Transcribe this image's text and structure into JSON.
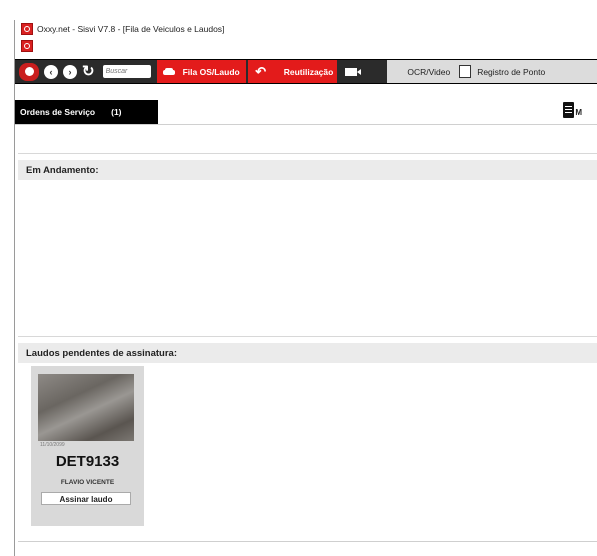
{
  "window": {
    "title": "Oxxy.net - Sisvi V7.8 - [Fila de Veiculos e Laudos]"
  },
  "toolbar": {
    "search_placeholder": "Buscar",
    "fila_label": "Fila OS/Laudo",
    "reutilizacao_label": "Reutilização",
    "ocr_label": "OCR/Video",
    "registro_label": "Registro de Ponto"
  },
  "tabs": {
    "ordens_label": "Ordens de Serviço",
    "ordens_count": "(1)",
    "doc_button_label": "M"
  },
  "sections": {
    "em_andamento": "Em Andamento:",
    "laudos_pendentes": "Laudos pendentes de assinatura:"
  },
  "laudo_card": {
    "meta": "11/10/2099",
    "plate": "DET9133",
    "name": "FLAVIO VICENTE",
    "button_label": "Assinar laudo"
  },
  "colors": {
    "toolbar_dark": "#2b2b2b",
    "accent_red": "#e31b1b",
    "section_bg": "#ebebeb",
    "card_bg": "#d9d9d9"
  }
}
